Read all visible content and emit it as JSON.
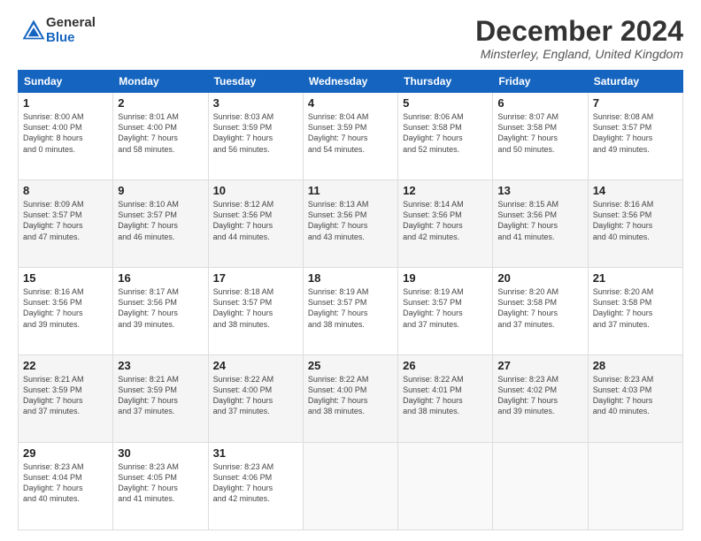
{
  "header": {
    "logo_general": "General",
    "logo_blue": "Blue",
    "title": "December 2024",
    "subtitle": "Minsterley, England, United Kingdom"
  },
  "days_of_week": [
    "Sunday",
    "Monday",
    "Tuesday",
    "Wednesday",
    "Thursday",
    "Friday",
    "Saturday"
  ],
  "weeks": [
    [
      {
        "day": "1",
        "info": "Sunrise: 8:00 AM\nSunset: 4:00 PM\nDaylight: 8 hours\nand 0 minutes."
      },
      {
        "day": "2",
        "info": "Sunrise: 8:01 AM\nSunset: 4:00 PM\nDaylight: 7 hours\nand 58 minutes."
      },
      {
        "day": "3",
        "info": "Sunrise: 8:03 AM\nSunset: 3:59 PM\nDaylight: 7 hours\nand 56 minutes."
      },
      {
        "day": "4",
        "info": "Sunrise: 8:04 AM\nSunset: 3:59 PM\nDaylight: 7 hours\nand 54 minutes."
      },
      {
        "day": "5",
        "info": "Sunrise: 8:06 AM\nSunset: 3:58 PM\nDaylight: 7 hours\nand 52 minutes."
      },
      {
        "day": "6",
        "info": "Sunrise: 8:07 AM\nSunset: 3:58 PM\nDaylight: 7 hours\nand 50 minutes."
      },
      {
        "day": "7",
        "info": "Sunrise: 8:08 AM\nSunset: 3:57 PM\nDaylight: 7 hours\nand 49 minutes."
      }
    ],
    [
      {
        "day": "8",
        "info": "Sunrise: 8:09 AM\nSunset: 3:57 PM\nDaylight: 7 hours\nand 47 minutes."
      },
      {
        "day": "9",
        "info": "Sunrise: 8:10 AM\nSunset: 3:57 PM\nDaylight: 7 hours\nand 46 minutes."
      },
      {
        "day": "10",
        "info": "Sunrise: 8:12 AM\nSunset: 3:56 PM\nDaylight: 7 hours\nand 44 minutes."
      },
      {
        "day": "11",
        "info": "Sunrise: 8:13 AM\nSunset: 3:56 PM\nDaylight: 7 hours\nand 43 minutes."
      },
      {
        "day": "12",
        "info": "Sunrise: 8:14 AM\nSunset: 3:56 PM\nDaylight: 7 hours\nand 42 minutes."
      },
      {
        "day": "13",
        "info": "Sunrise: 8:15 AM\nSunset: 3:56 PM\nDaylight: 7 hours\nand 41 minutes."
      },
      {
        "day": "14",
        "info": "Sunrise: 8:16 AM\nSunset: 3:56 PM\nDaylight: 7 hours\nand 40 minutes."
      }
    ],
    [
      {
        "day": "15",
        "info": "Sunrise: 8:16 AM\nSunset: 3:56 PM\nDaylight: 7 hours\nand 39 minutes."
      },
      {
        "day": "16",
        "info": "Sunrise: 8:17 AM\nSunset: 3:56 PM\nDaylight: 7 hours\nand 39 minutes."
      },
      {
        "day": "17",
        "info": "Sunrise: 8:18 AM\nSunset: 3:57 PM\nDaylight: 7 hours\nand 38 minutes."
      },
      {
        "day": "18",
        "info": "Sunrise: 8:19 AM\nSunset: 3:57 PM\nDaylight: 7 hours\nand 38 minutes."
      },
      {
        "day": "19",
        "info": "Sunrise: 8:19 AM\nSunset: 3:57 PM\nDaylight: 7 hours\nand 37 minutes."
      },
      {
        "day": "20",
        "info": "Sunrise: 8:20 AM\nSunset: 3:58 PM\nDaylight: 7 hours\nand 37 minutes."
      },
      {
        "day": "21",
        "info": "Sunrise: 8:20 AM\nSunset: 3:58 PM\nDaylight: 7 hours\nand 37 minutes."
      }
    ],
    [
      {
        "day": "22",
        "info": "Sunrise: 8:21 AM\nSunset: 3:59 PM\nDaylight: 7 hours\nand 37 minutes."
      },
      {
        "day": "23",
        "info": "Sunrise: 8:21 AM\nSunset: 3:59 PM\nDaylight: 7 hours\nand 37 minutes."
      },
      {
        "day": "24",
        "info": "Sunrise: 8:22 AM\nSunset: 4:00 PM\nDaylight: 7 hours\nand 37 minutes."
      },
      {
        "day": "25",
        "info": "Sunrise: 8:22 AM\nSunset: 4:00 PM\nDaylight: 7 hours\nand 38 minutes."
      },
      {
        "day": "26",
        "info": "Sunrise: 8:22 AM\nSunset: 4:01 PM\nDaylight: 7 hours\nand 38 minutes."
      },
      {
        "day": "27",
        "info": "Sunrise: 8:23 AM\nSunset: 4:02 PM\nDaylight: 7 hours\nand 39 minutes."
      },
      {
        "day": "28",
        "info": "Sunrise: 8:23 AM\nSunset: 4:03 PM\nDaylight: 7 hours\nand 40 minutes."
      }
    ],
    [
      {
        "day": "29",
        "info": "Sunrise: 8:23 AM\nSunset: 4:04 PM\nDaylight: 7 hours\nand 40 minutes."
      },
      {
        "day": "30",
        "info": "Sunrise: 8:23 AM\nSunset: 4:05 PM\nDaylight: 7 hours\nand 41 minutes."
      },
      {
        "day": "31",
        "info": "Sunrise: 8:23 AM\nSunset: 4:06 PM\nDaylight: 7 hours\nand 42 minutes."
      },
      null,
      null,
      null,
      null
    ]
  ]
}
